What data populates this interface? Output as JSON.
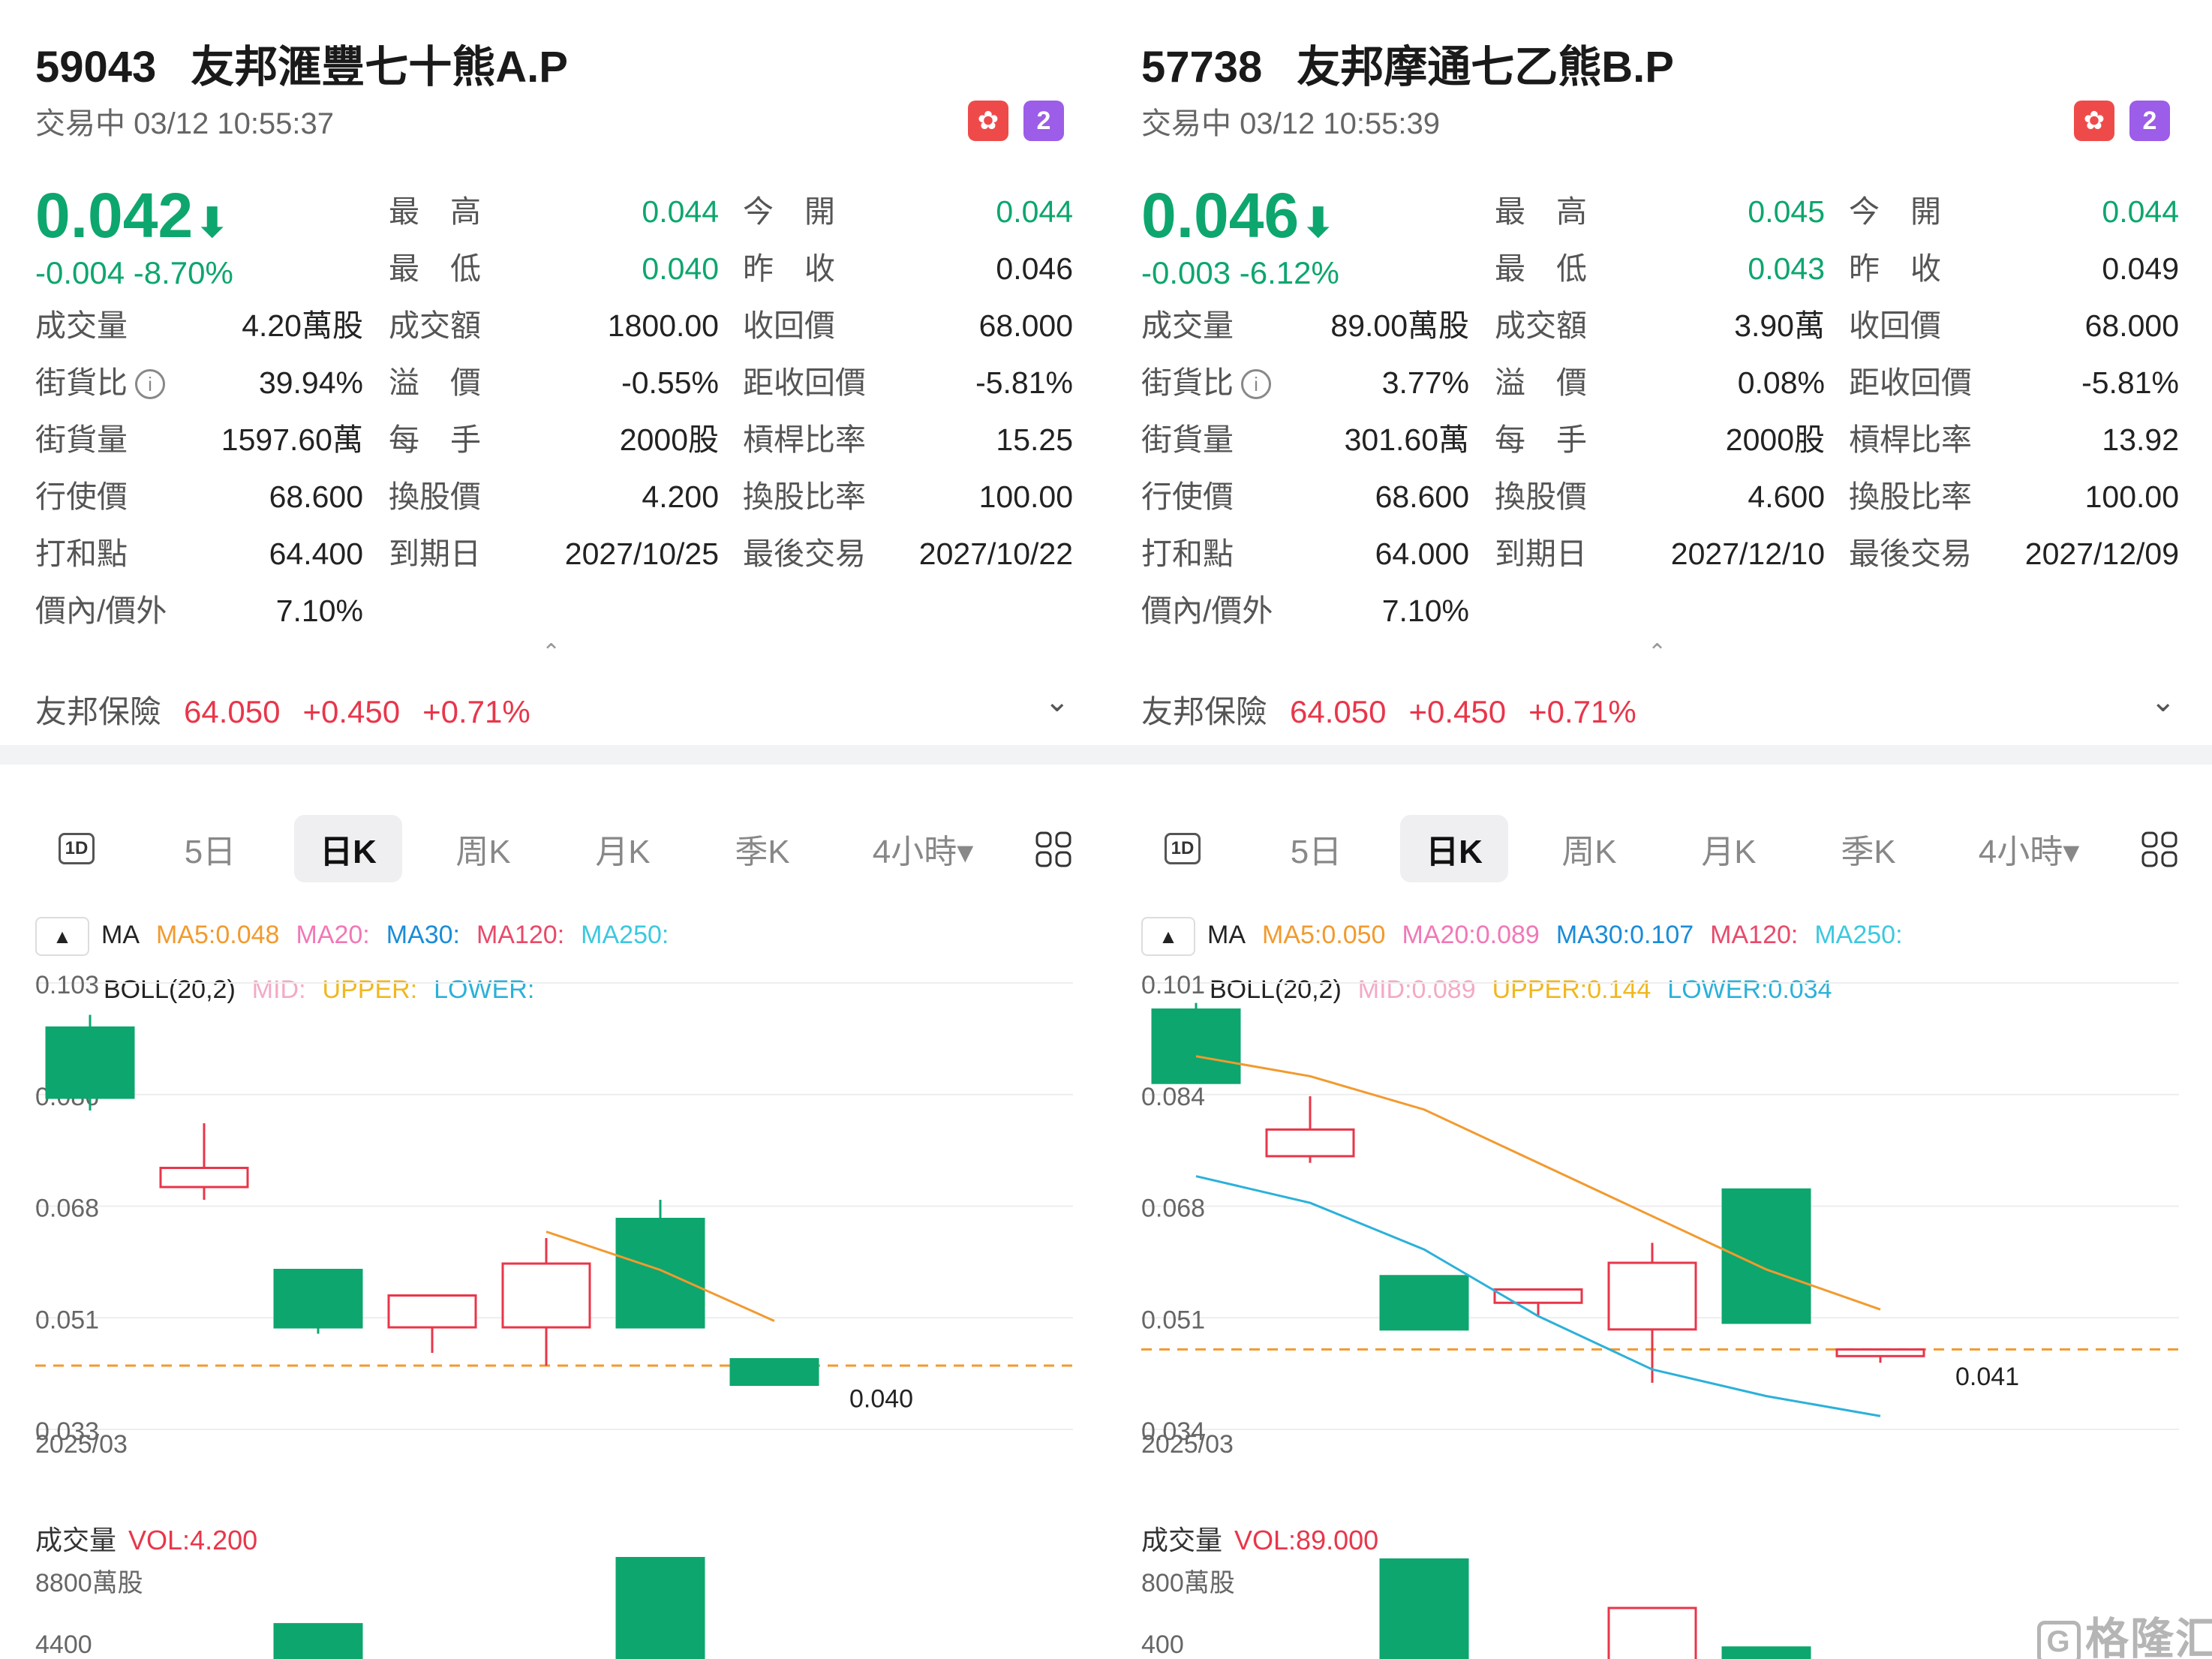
{
  "panels": [
    {
      "code": "59043",
      "name": "友邦滙豐七十熊A.P",
      "status": "交易中 03/12 10:55:37",
      "badges": {
        "hk": "✿",
        "lv": "2"
      },
      "price": "0.042",
      "arrow": "⬇",
      "change": "-0.004  -8.70%",
      "stats": [
        {
          "label": "最　高",
          "value": "0.044",
          "green": true
        },
        {
          "label": "今　開",
          "value": "0.044",
          "green": true
        },
        {
          "label": "最　低",
          "value": "0.040",
          "green": true
        },
        {
          "label": "昨　收",
          "value": "0.046"
        },
        {
          "label": "成交量",
          "value": "4.20萬股"
        },
        {
          "label": "成交額",
          "value": "1800.00"
        },
        {
          "label": "收回價",
          "value": "68.000"
        },
        {
          "label": "街貨比",
          "value": "39.94%",
          "info": "i"
        },
        {
          "label": "溢　價",
          "value": "-0.55%"
        },
        {
          "label": "距收回價",
          "value": "-5.81%"
        },
        {
          "label": "街貨量",
          "value": "1597.60萬"
        },
        {
          "label": "每　手",
          "value": "2000股"
        },
        {
          "label": "槓桿比率",
          "value": "15.25"
        },
        {
          "label": "行使價",
          "value": "68.600"
        },
        {
          "label": "換股價",
          "value": "4.200"
        },
        {
          "label": "換股比率",
          "value": "100.00"
        },
        {
          "label": "打和點",
          "value": "64.400"
        },
        {
          "label": "到期日",
          "value": "2027/10/25"
        },
        {
          "label": "最後交易",
          "value": "2027/10/22"
        },
        {
          "label": "價內/價外",
          "value": "7.10%"
        }
      ],
      "underlying": {
        "name": "友邦保險",
        "price": "64.050",
        "change": "+0.450",
        "pct": "+0.71%"
      },
      "tabs": [
        "1D",
        "5日",
        "日K",
        "周K",
        "月K",
        "季K",
        "4小時▾"
      ],
      "active_tab": "日K",
      "ma": {
        "toggle": "▲",
        "label": "MA",
        "ma5": "MA5:0.048",
        "ma20": "MA20:",
        "ma30": "MA30:",
        "ma120": "MA120:",
        "ma250": "MA250:"
      },
      "boll": {
        "label": "BOLL(20,2)",
        "mid": "MID:",
        "upper": "UPPER:",
        "lower": "LOWER:"
      },
      "vol": {
        "title": "成交量",
        "value": "VOL:4.200",
        "y_max": "8800萬股",
        "y_mid": "4400"
      },
      "chart_data": {
        "type": "candlestick",
        "x_label": "2025/03",
        "y_ticks": [
          "0.103",
          "0.086",
          "0.068",
          "0.051",
          "0.033"
        ],
        "ylim": [
          0.033,
          0.103
        ],
        "candles": [
          {
            "open": 0.096,
            "close": 0.085,
            "high": 0.098,
            "low": 0.083
          },
          {
            "open": 0.071,
            "close": 0.074,
            "high": 0.081,
            "low": 0.069
          },
          {
            "open": 0.058,
            "close": 0.049,
            "high": 0.058,
            "low": 0.048
          },
          {
            "open": 0.049,
            "close": 0.054,
            "high": 0.054,
            "low": 0.045
          },
          {
            "open": 0.049,
            "close": 0.059,
            "high": 0.063,
            "low": 0.043
          },
          {
            "open": 0.066,
            "close": 0.049,
            "high": 0.069,
            "low": 0.049
          },
          {
            "open": 0.044,
            "close": 0.04,
            "high": 0.044,
            "low": 0.04
          }
        ],
        "ma5": [
          null,
          null,
          null,
          null,
          0.064,
          0.058,
          0.05
        ],
        "ref_line": 0.043,
        "last_label": "0.040",
        "volumes": [
          null,
          null,
          3000,
          null,
          null,
          8800,
          null
        ]
      }
    },
    {
      "code": "57738",
      "name": "友邦摩通七乙熊B.P",
      "status": "交易中 03/12 10:55:39",
      "badges": {
        "hk": "✿",
        "lv": "2"
      },
      "price": "0.046",
      "arrow": "⬇",
      "change": "-0.003  -6.12%",
      "stats": [
        {
          "label": "最　高",
          "value": "0.045",
          "green": true
        },
        {
          "label": "今　開",
          "value": "0.044",
          "green": true
        },
        {
          "label": "最　低",
          "value": "0.043",
          "green": true
        },
        {
          "label": "昨　收",
          "value": "0.049"
        },
        {
          "label": "成交量",
          "value": "89.00萬股"
        },
        {
          "label": "成交額",
          "value": "3.90萬"
        },
        {
          "label": "收回價",
          "value": "68.000"
        },
        {
          "label": "街貨比",
          "value": "3.77%",
          "info": "i"
        },
        {
          "label": "溢　價",
          "value": "0.08%"
        },
        {
          "label": "距收回價",
          "value": "-5.81%"
        },
        {
          "label": "街貨量",
          "value": "301.60萬"
        },
        {
          "label": "每　手",
          "value": "2000股"
        },
        {
          "label": "槓桿比率",
          "value": "13.92"
        },
        {
          "label": "行使價",
          "value": "68.600"
        },
        {
          "label": "換股價",
          "value": "4.600"
        },
        {
          "label": "換股比率",
          "value": "100.00"
        },
        {
          "label": "打和點",
          "value": "64.000"
        },
        {
          "label": "到期日",
          "value": "2027/12/10"
        },
        {
          "label": "最後交易",
          "value": "2027/12/09"
        },
        {
          "label": "價內/價外",
          "value": "7.10%"
        }
      ],
      "underlying": {
        "name": "友邦保險",
        "price": "64.050",
        "change": "+0.450",
        "pct": "+0.71%"
      },
      "tabs": [
        "1D",
        "5日",
        "日K",
        "周K",
        "月K",
        "季K",
        "4小時▾"
      ],
      "active_tab": "日K",
      "ma": {
        "toggle": "▲",
        "label": "MA",
        "ma5": "MA5:0.050",
        "ma20": "MA20:0.089",
        "ma30": "MA30:0.107",
        "ma120": "MA120:",
        "ma250": "MA250:"
      },
      "boll": {
        "label": "BOLL(20,2)",
        "mid": "MID:0.089",
        "upper": "UPPER:0.144",
        "lower": "LOWER:0.034"
      },
      "vol": {
        "title": "成交量",
        "value": "VOL:89.000",
        "y_max": "800萬股",
        "y_mid": "400"
      },
      "chart_data": {
        "type": "candlestick",
        "x_label": "2025/03",
        "y_ticks": [
          "0.101",
          "0.084",
          "0.068",
          "0.051",
          "0.034"
        ],
        "ylim": [
          0.034,
          0.101
        ],
        "candles": [
          {
            "open": 0.097,
            "close": 0.086,
            "high": 0.098,
            "low": 0.086
          },
          {
            "open": 0.075,
            "close": 0.079,
            "high": 0.084,
            "low": 0.074
          },
          {
            "open": 0.057,
            "close": 0.049,
            "high": 0.057,
            "low": 0.049
          },
          {
            "open": 0.053,
            "close": 0.055,
            "high": 0.055,
            "low": 0.051
          },
          {
            "open": 0.049,
            "close": 0.059,
            "high": 0.062,
            "low": 0.041
          },
          {
            "open": 0.07,
            "close": 0.05,
            "high": 0.07,
            "low": 0.05
          },
          {
            "open": 0.045,
            "close": 0.046,
            "high": 0.046,
            "low": 0.044
          }
        ],
        "ma5": [
          0.09,
          0.087,
          0.082,
          0.074,
          0.066,
          0.058,
          0.052
        ],
        "ma30": [
          0.072,
          0.068,
          0.061,
          0.051,
          0.043,
          0.039,
          0.036
        ],
        "ref_line": 0.046,
        "last_label": "0.041",
        "volumes": [
          null,
          null,
          780,
          null,
          400,
          90,
          null
        ]
      }
    }
  ],
  "watermark": {
    "logo": "G",
    "text": "格隆汇"
  },
  "colors": {
    "up": "#e8364a",
    "down": "#0da66e",
    "ma5": "#f29a2e",
    "ma20": "#f178b6",
    "ma30": "#1a8cd8",
    "ma120": "#e84a6a",
    "ma250": "#3cc8e0",
    "upper": "#f0b81e",
    "mid": "#f4a9c6",
    "lower": "#2bb1d9"
  }
}
